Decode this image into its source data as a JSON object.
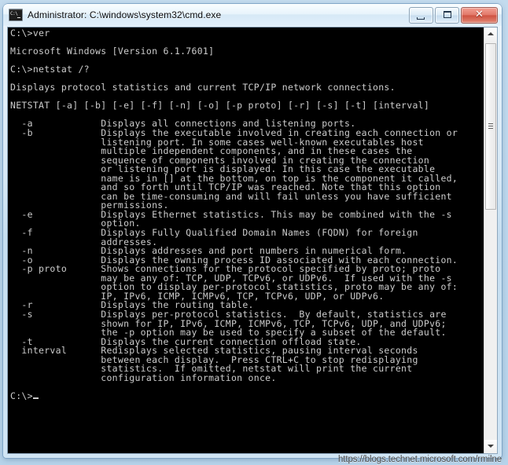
{
  "window": {
    "title": "Administrator: C:\\windows\\system32\\cmd.exe",
    "icon": "cmd-icon",
    "buttons": {
      "minimize_label": "–",
      "maximize_label": "□",
      "close_label": "✕"
    }
  },
  "console": {
    "background_color": "#000000",
    "text_color": "#cccccc",
    "lines": [
      "C:\\>ver",
      "",
      "Microsoft Windows [Version 6.1.7601]",
      "",
      "C:\\>netstat /?",
      "",
      "Displays protocol statistics and current TCP/IP network connections.",
      "",
      "NETSTAT [-a] [-b] [-e] [-f] [-n] [-o] [-p proto] [-r] [-s] [-t] [interval]",
      "",
      "  -a            Displays all connections and listening ports.",
      "  -b            Displays the executable involved in creating each connection or",
      "                listening port. In some cases well-known executables host",
      "                multiple independent components, and in these cases the",
      "                sequence of components involved in creating the connection",
      "                or listening port is displayed. In this case the executable",
      "                name is in [] at the bottom, on top is the component it called,",
      "                and so forth until TCP/IP was reached. Note that this option",
      "                can be time-consuming and will fail unless you have sufficient",
      "                permissions.",
      "  -e            Displays Ethernet statistics. This may be combined with the -s",
      "                option.",
      "  -f            Displays Fully Qualified Domain Names (FQDN) for foreign",
      "                addresses.",
      "  -n            Displays addresses and port numbers in numerical form.",
      "  -o            Displays the owning process ID associated with each connection.",
      "  -p proto      Shows connections for the protocol specified by proto; proto",
      "                may be any of: TCP, UDP, TCPv6, or UDPv6.  If used with the -s",
      "                option to display per-protocol statistics, proto may be any of:",
      "                IP, IPv6, ICMP, ICMPv6, TCP, TCPv6, UDP, or UDPv6.",
      "  -r            Displays the routing table.",
      "  -s            Displays per-protocol statistics.  By default, statistics are",
      "                shown for IP, IPv6, ICMP, ICMPv6, TCP, TCPv6, UDP, and UDPv6;",
      "                the -p option may be used to specify a subset of the default.",
      "  -t            Displays the current connection offload state.",
      "  interval      Redisplays selected statistics, pausing interval seconds",
      "                between each display.  Press CTRL+C to stop redisplaying",
      "                statistics.  If omitted, netstat will print the current",
      "                configuration information once.",
      "",
      "C:\\>"
    ],
    "prompt": "C:\\>",
    "cursor": "_"
  },
  "scrollbar": {
    "up_arrow": "scroll-up-arrow",
    "down_arrow": "scroll-down-arrow",
    "thumb": "scroll-thumb"
  },
  "watermark": {
    "text": "https://blogs.technet.microsoft.com/rmilne"
  }
}
